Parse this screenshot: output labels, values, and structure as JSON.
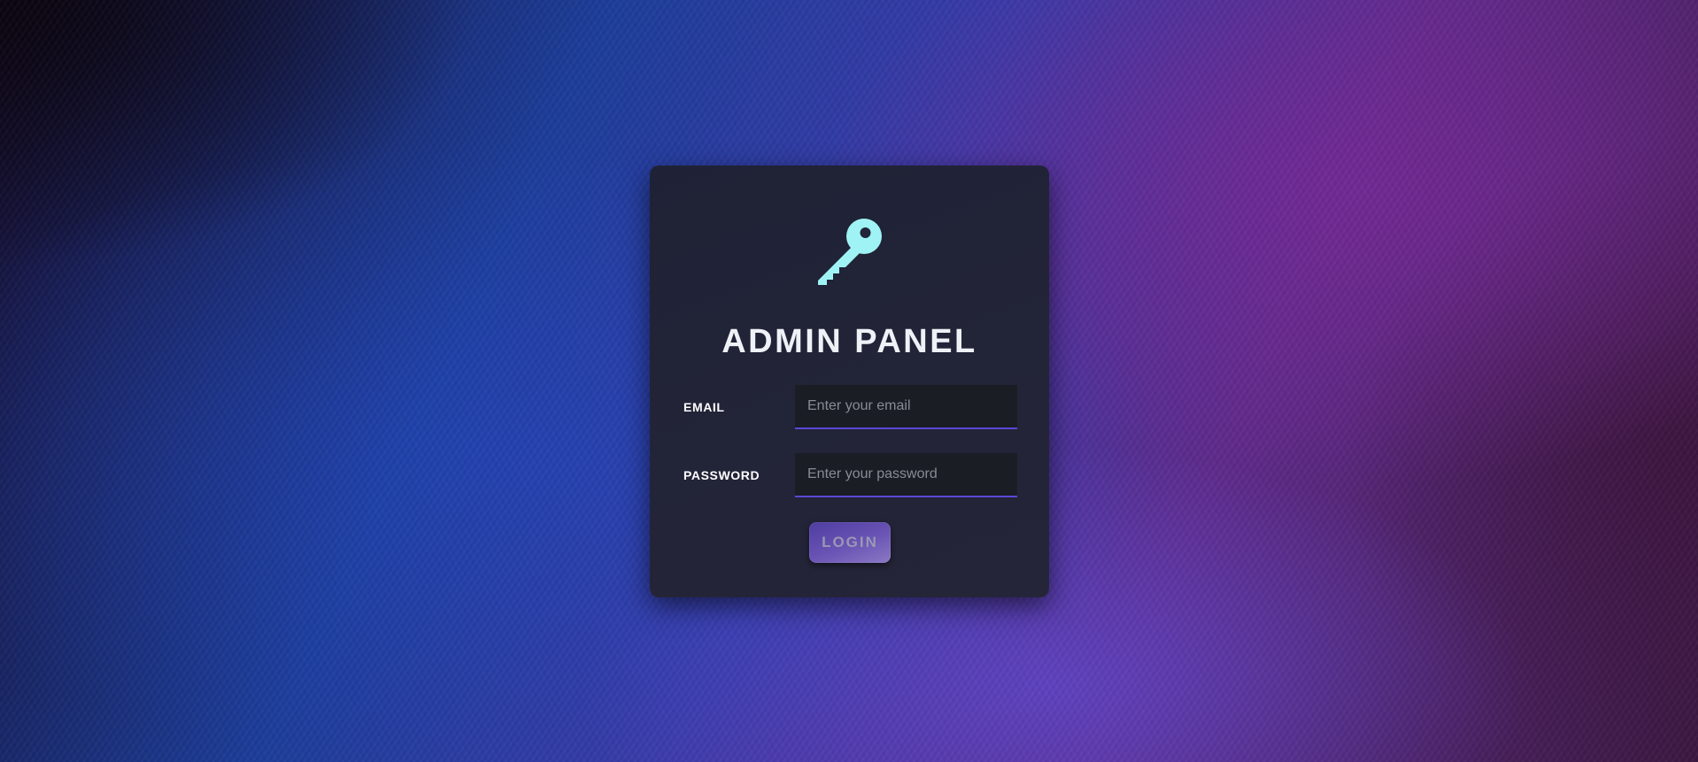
{
  "login": {
    "title": "ADMIN PANEL",
    "email_label": "EMAIL",
    "email_placeholder": "Enter your email",
    "password_label": "PASSWORD",
    "password_placeholder": "Enter your password",
    "submit_label": "LOGIN"
  },
  "icons": {
    "logo": "key-icon"
  },
  "colors": {
    "icon_accent": "#9ff3f4",
    "card_background": "#22243a",
    "input_underline": "#5b47d6",
    "button_gradient_start": "#4e3da0",
    "button_gradient_end": "#8b78c4",
    "title_text": "#eef1f6"
  }
}
